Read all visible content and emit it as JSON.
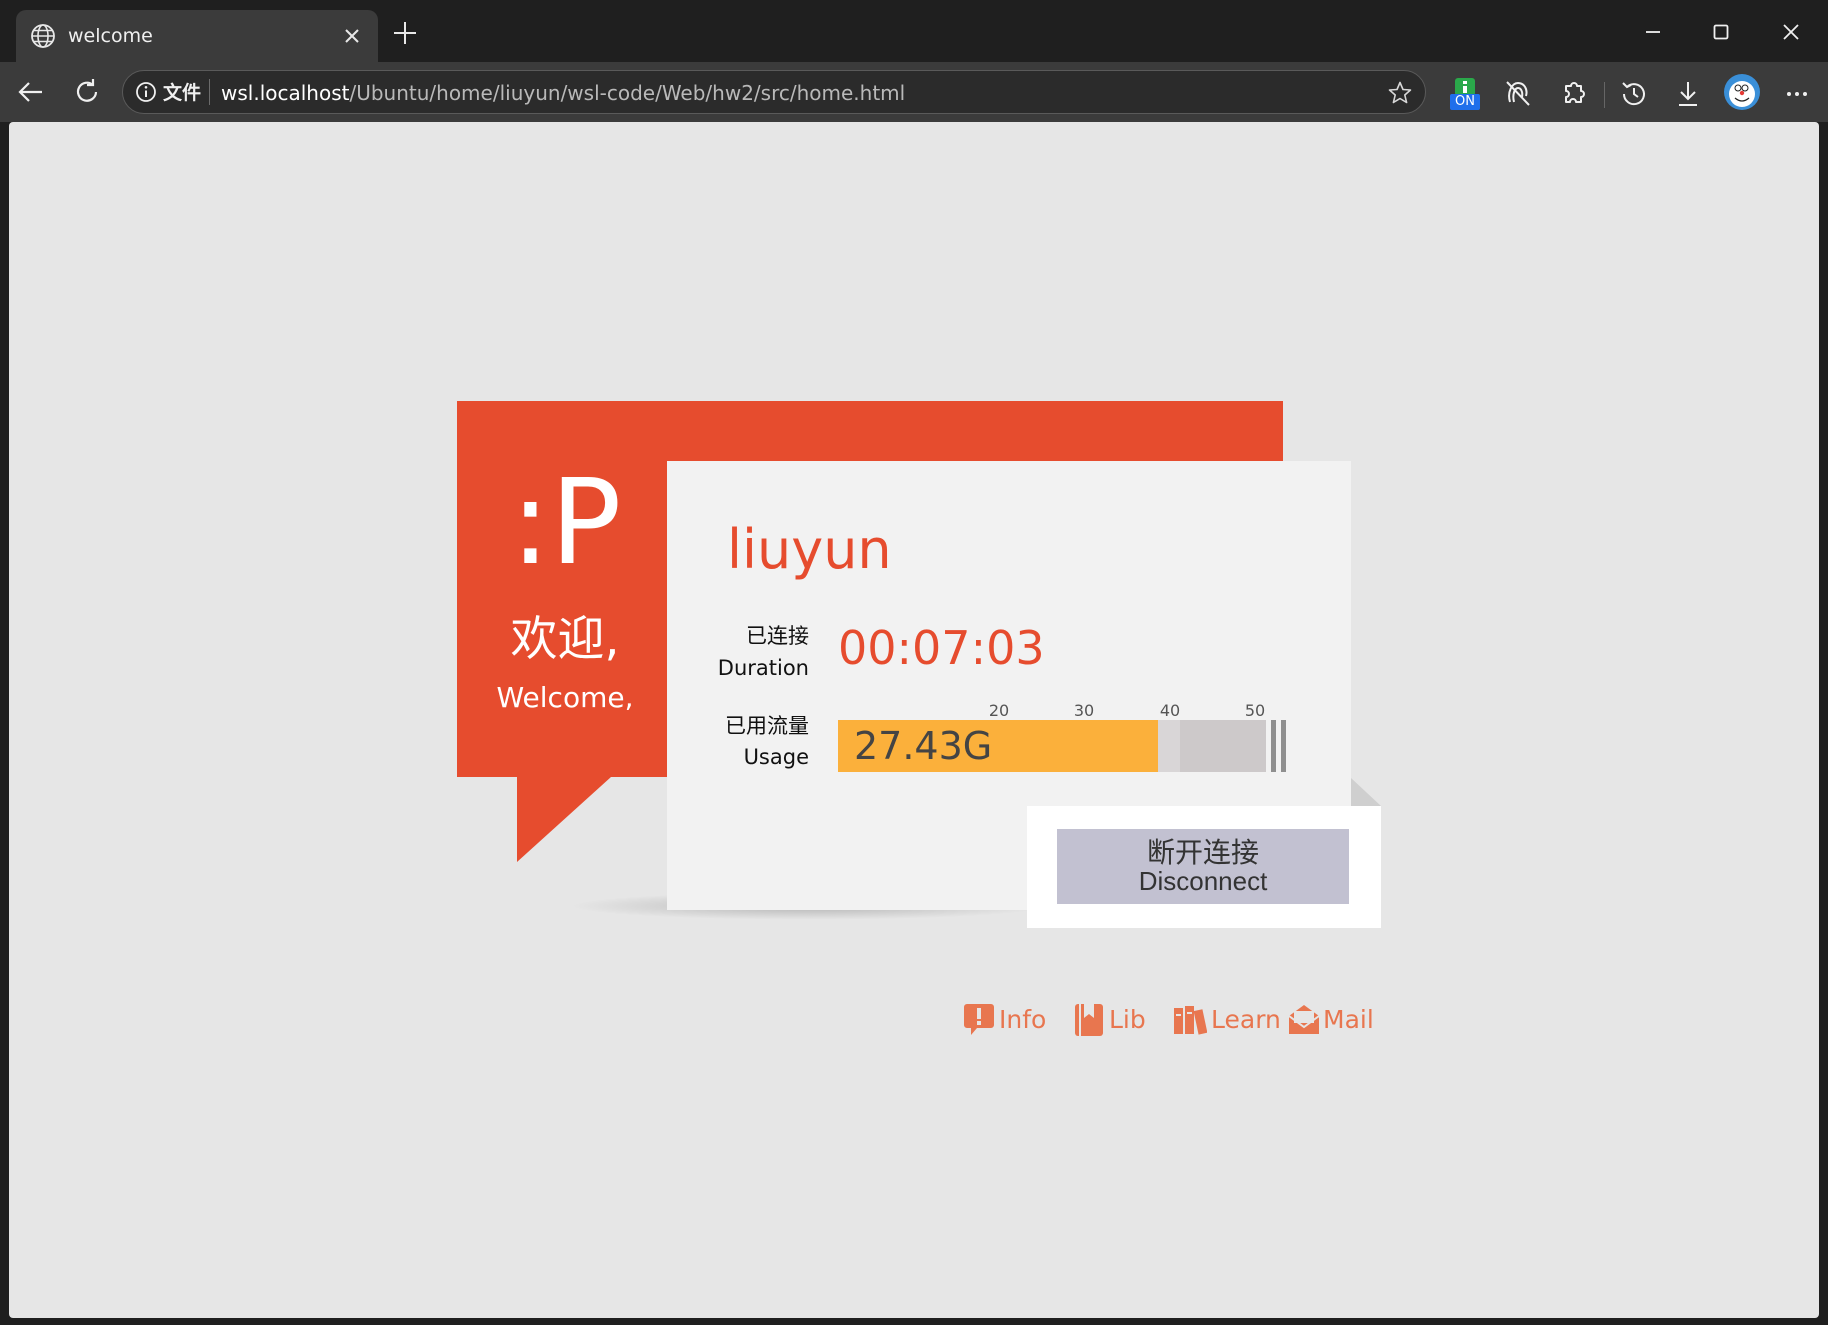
{
  "browser": {
    "tab_title": "welcome",
    "address": {
      "file_label": "文件",
      "host": "wsl.localhost",
      "path": "/Ubuntu/home/liuyun/wsl-code/Web/hw2/src/home.html"
    },
    "extension_badge": "ON",
    "icons": [
      "globe-icon",
      "close-icon",
      "plus-icon",
      "minimize-icon",
      "maximize-icon",
      "back-icon",
      "refresh-icon",
      "info-icon",
      "star-icon",
      "extension-on-icon",
      "tracking-icon",
      "puzzle-icon",
      "history-icon",
      "download-icon",
      "avatar",
      "more-icon"
    ]
  },
  "page": {
    "emoticon": ":P",
    "welcome_zh": "欢迎,",
    "welcome_en": "Welcome,",
    "username": "liuyun",
    "duration": {
      "label_zh": "已连接",
      "label_en": "Duration",
      "value": "00:07:03"
    },
    "usage": {
      "label_zh": "已用流量",
      "label_en": "Usage",
      "value": "27.43G",
      "amount_gb": 27.43,
      "ticks": [
        "20",
        "30",
        "40",
        "50"
      ]
    },
    "disconnect": {
      "label_zh": "断开连接",
      "label_en": "Disconnect"
    },
    "links": [
      {
        "label": "Info",
        "icon": "alert-icon"
      },
      {
        "label": "Lib",
        "icon": "book-icon"
      },
      {
        "label": "Learn",
        "icon": "books-icon"
      },
      {
        "label": "Mail",
        "icon": "mail-icon"
      }
    ],
    "colors": {
      "accent": "#e64c2e",
      "usage_fill": "#fbb03b",
      "button": "#c2c1d1",
      "link": "#e8764f",
      "background": "#e6e6e6"
    }
  }
}
